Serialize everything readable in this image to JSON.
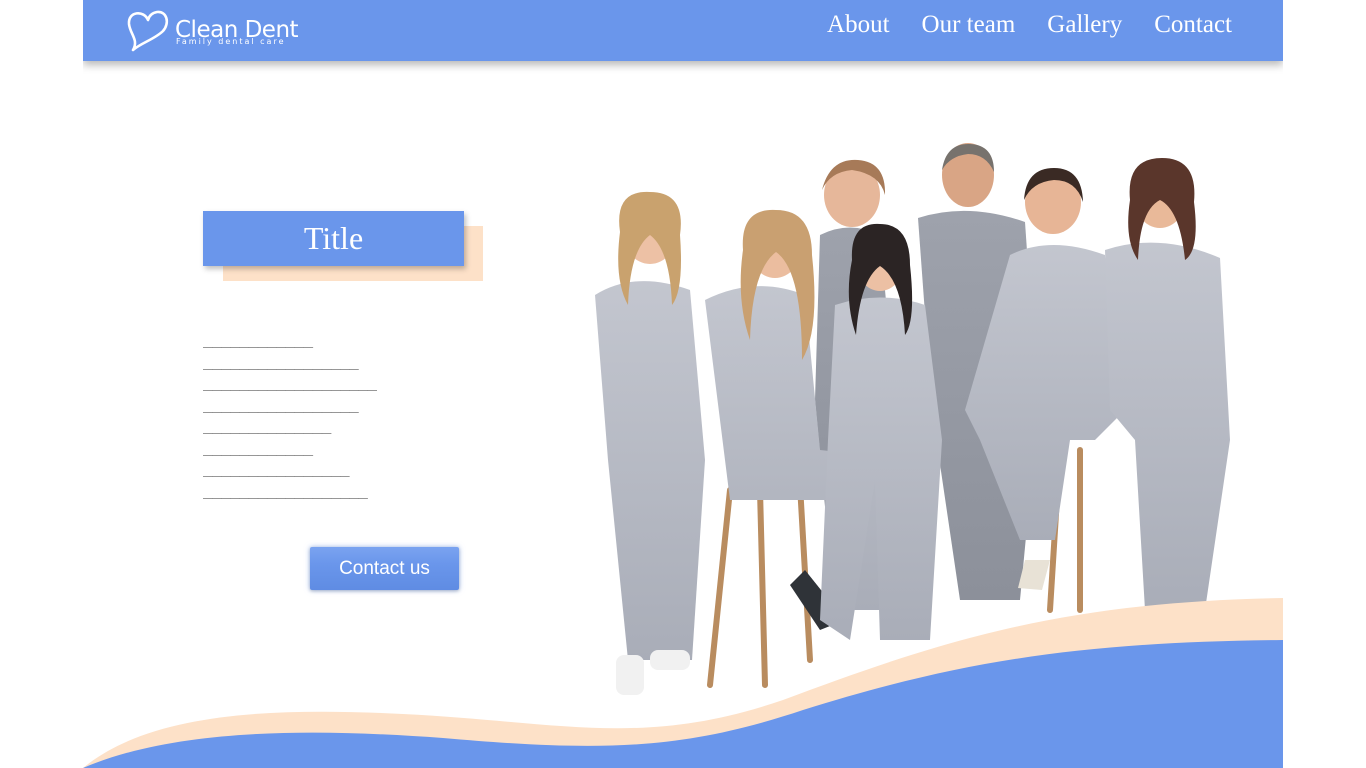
{
  "header": {
    "brand": "Clean Dent",
    "tagline": "Family dental care",
    "nav": [
      "About",
      "Our team",
      "Gallery",
      "Contact"
    ]
  },
  "hero": {
    "title": "Title",
    "placeholder_lines": [
      "____________",
      "_________________",
      "___________________",
      "_________________",
      "______________",
      "____________",
      "________________",
      "__________________"
    ],
    "button_label": "Contact us"
  },
  "colors": {
    "primary": "#6a96eb",
    "accent_peach": "#fde1c8",
    "white": "#ffffff"
  },
  "icons": {
    "logo": "heart-icon"
  }
}
